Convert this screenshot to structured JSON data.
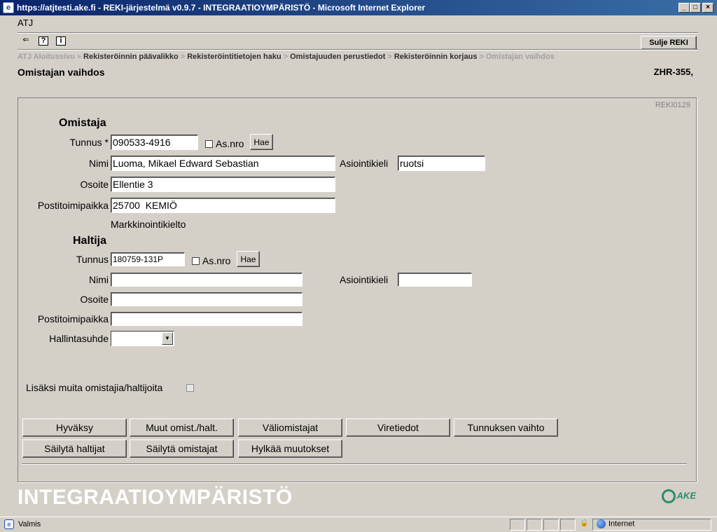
{
  "window": {
    "title": "https://atjtesti.ake.fi - REKI-järjestelmä v0.9.7 - INTEGRAATIOYMPÄRISTÖ - Microsoft Internet Explorer"
  },
  "app": {
    "system_label": "ATJ",
    "close_button": "Sulje REKI"
  },
  "breadcrumb": [
    "ATJ Aloitussivu",
    "Rekisteröinnin päävalikko",
    "Rekisteröintitietojen haku",
    "Omistajuuden perustiedot",
    "Rekisteröinnin korjaus",
    "Omistajan vaihdos"
  ],
  "breadcrumb_separator": "»",
  "breadcrumb_separator_alt": ">",
  "page": {
    "title": "Omistajan vaihdos",
    "registration": "ZHR-355,",
    "form_code": "REKI0129"
  },
  "owner": {
    "section_title": "Omistaja",
    "id_label": "Tunnus *",
    "id_value": "090533-4916",
    "asnro_label": "As.nro",
    "search_button": "Hae",
    "name_label": "Nimi",
    "name_value": "Luoma, Mikael Edward Sebastian",
    "lang_label": "Asiointikieli",
    "lang_value": "ruotsi",
    "address_label": "Osoite",
    "address_value": "Ellentie 3",
    "postal_label": "Postitoimipaikka",
    "postal_value": "25700  KEMIÖ",
    "marketing_ban": "Markkinointikielto"
  },
  "holder": {
    "section_title": "Haltija",
    "id_label": "Tunnus",
    "id_value": "180759-131P",
    "asnro_label": "As.nro",
    "search_button": "Hae",
    "name_label": "Nimi",
    "name_value": "",
    "lang_label": "Asiointikieli",
    "lang_value": "",
    "address_label": "Osoite",
    "address_value": "",
    "postal_label": "Postitoimipaikka",
    "postal_value": "",
    "relation_label": "Hallintasuhde",
    "relation_value": ""
  },
  "more_owners_label": "Lisäksi muita omistajia/haltijoita",
  "actions": {
    "row1": [
      "Hyväksy",
      "Muut omist./halt.",
      "Väliomistajat",
      "Viretiedot",
      "Tunnuksen vaihto"
    ],
    "row2": [
      "Säilytä haltijat",
      "Säilytä omistajat",
      "Hylkää muutokset"
    ]
  },
  "environment_label": "INTEGRAATIOYMPÄRISTÖ",
  "logo_text": "AKE",
  "status": {
    "text": "Valmis",
    "zone": "Internet"
  },
  "colors": {
    "titlebar_start": "#0a246a",
    "titlebar_end": "#3a6ea5",
    "face": "#d4d0c8",
    "logo_green": "#2a8c6b"
  }
}
